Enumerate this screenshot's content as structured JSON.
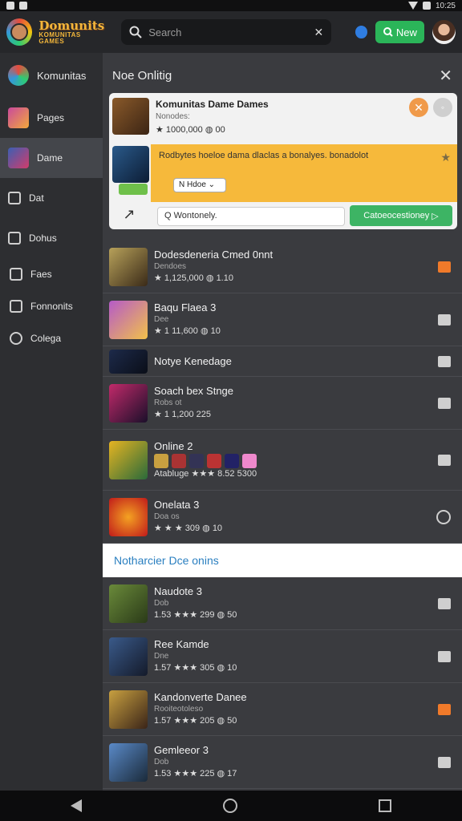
{
  "status": {
    "time": "10:25"
  },
  "topbar": {
    "brand_line1": "Domunits",
    "brand_line2": "KOMUNITAS GAMES",
    "search_placeholder": "Search",
    "new_button": "New"
  },
  "sidebar": {
    "header": "Komunitas",
    "items": [
      {
        "label": "Pages"
      },
      {
        "label": "Dame"
      },
      {
        "label": "Dat"
      },
      {
        "label": "Dohus"
      },
      {
        "label": "Faes"
      },
      {
        "label": "Fonnonits"
      },
      {
        "label": "Colega"
      }
    ]
  },
  "main": {
    "title": "Noe Onlitig",
    "card": {
      "title": "Komunitas Dame Dames",
      "subtitle": "Nonodes:",
      "rating": "★ 1000,000  ◍ 00",
      "banner_text": "Rodbytes hoeloe dama dlaclas a bonalyes. bonadolot",
      "dropdown": "N Hdoe",
      "input_value": "Q Wontonely.",
      "action_button": "Catoeocestioney"
    },
    "rows": [
      {
        "title": "Dodesdeneria Cmed 0nnt",
        "sub": "Dendoes",
        "rating": "★ 1,125,000  ◍ 1.10"
      },
      {
        "title": "Baqu Flaea 3",
        "sub": "Dee",
        "rating": "★ 1 11,600  ◍ 10"
      },
      {
        "title": "Notye Kenedage",
        "sub": "",
        "rating": ""
      },
      {
        "title": "Soach bex Stnge",
        "sub": "Robs ot",
        "rating": "★ 1 1,200 225"
      },
      {
        "title": "Online 2",
        "sub": "",
        "rating": "Atabluge ★★★ 8.52 5300"
      },
      {
        "title": "Onelata 3",
        "sub": "Doa os",
        "rating": "★ ★ ★ 309  ◍ 10"
      }
    ],
    "section_title": "Notharcier Dce onins",
    "rows2": [
      {
        "title": "Naudote 3",
        "sub": "Dob",
        "rating": "1.53 ★★★ 299  ◍ 50"
      },
      {
        "title": "Ree Kamde",
        "sub": "Dne",
        "rating": "1.57 ★★★ 305  ◍ 10"
      },
      {
        "title": "Kandonverte Danee",
        "sub": "Rooiteotoleso",
        "rating": "1.57 ★★★ 205  ◍ 50"
      },
      {
        "title": "Gemleeor 3",
        "sub": "Dob",
        "rating": "1.53 ★★★ 225  ◍ 17"
      }
    ]
  }
}
